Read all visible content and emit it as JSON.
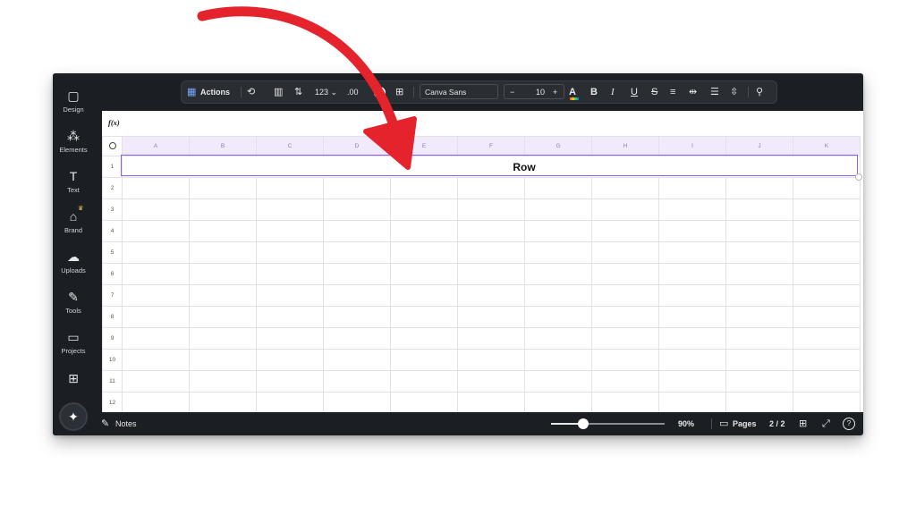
{
  "rail": {
    "items": [
      {
        "label": "Design",
        "icon": "▢"
      },
      {
        "label": "Elements",
        "icon": "⁂"
      },
      {
        "label": "Text",
        "icon": "T"
      },
      {
        "label": "Brand",
        "icon": "⌂"
      },
      {
        "label": "Uploads",
        "icon": "☁"
      },
      {
        "label": "Tools",
        "icon": "✎"
      },
      {
        "label": "Projects",
        "icon": "▭"
      },
      {
        "label": "",
        "icon": "⊞"
      }
    ],
    "magic_icon": "✦"
  },
  "toolbar": {
    "actions_label": "Actions",
    "number_format": "123",
    "decimal_label": ".00",
    "font_name": "Canva Sans",
    "font_size": "10",
    "minus": "−",
    "plus": "+",
    "bold": "B",
    "italic": "I",
    "underline": "U",
    "strike": "S"
  },
  "formula_bar": {
    "label": "f(x)"
  },
  "sheet": {
    "columns": [
      "A",
      "B",
      "C",
      "D",
      "E",
      "F",
      "G",
      "H",
      "I",
      "J",
      "K"
    ],
    "rows": [
      "1",
      "2",
      "3",
      "4",
      "5",
      "6",
      "7",
      "8",
      "9",
      "10",
      "11",
      "12"
    ],
    "merged_row_text": "Row"
  },
  "bottom": {
    "notes_label": "Notes",
    "zoom": "90%",
    "zoom_fraction": 0.28,
    "pages_label": "Pages",
    "page_count": "2 / 2",
    "help": "?"
  },
  "colors": {
    "accent": "#8b5cf6",
    "arrow": "#e4232d",
    "header_bg": "#f1eafd",
    "editor_bg": "#1b1e22"
  }
}
